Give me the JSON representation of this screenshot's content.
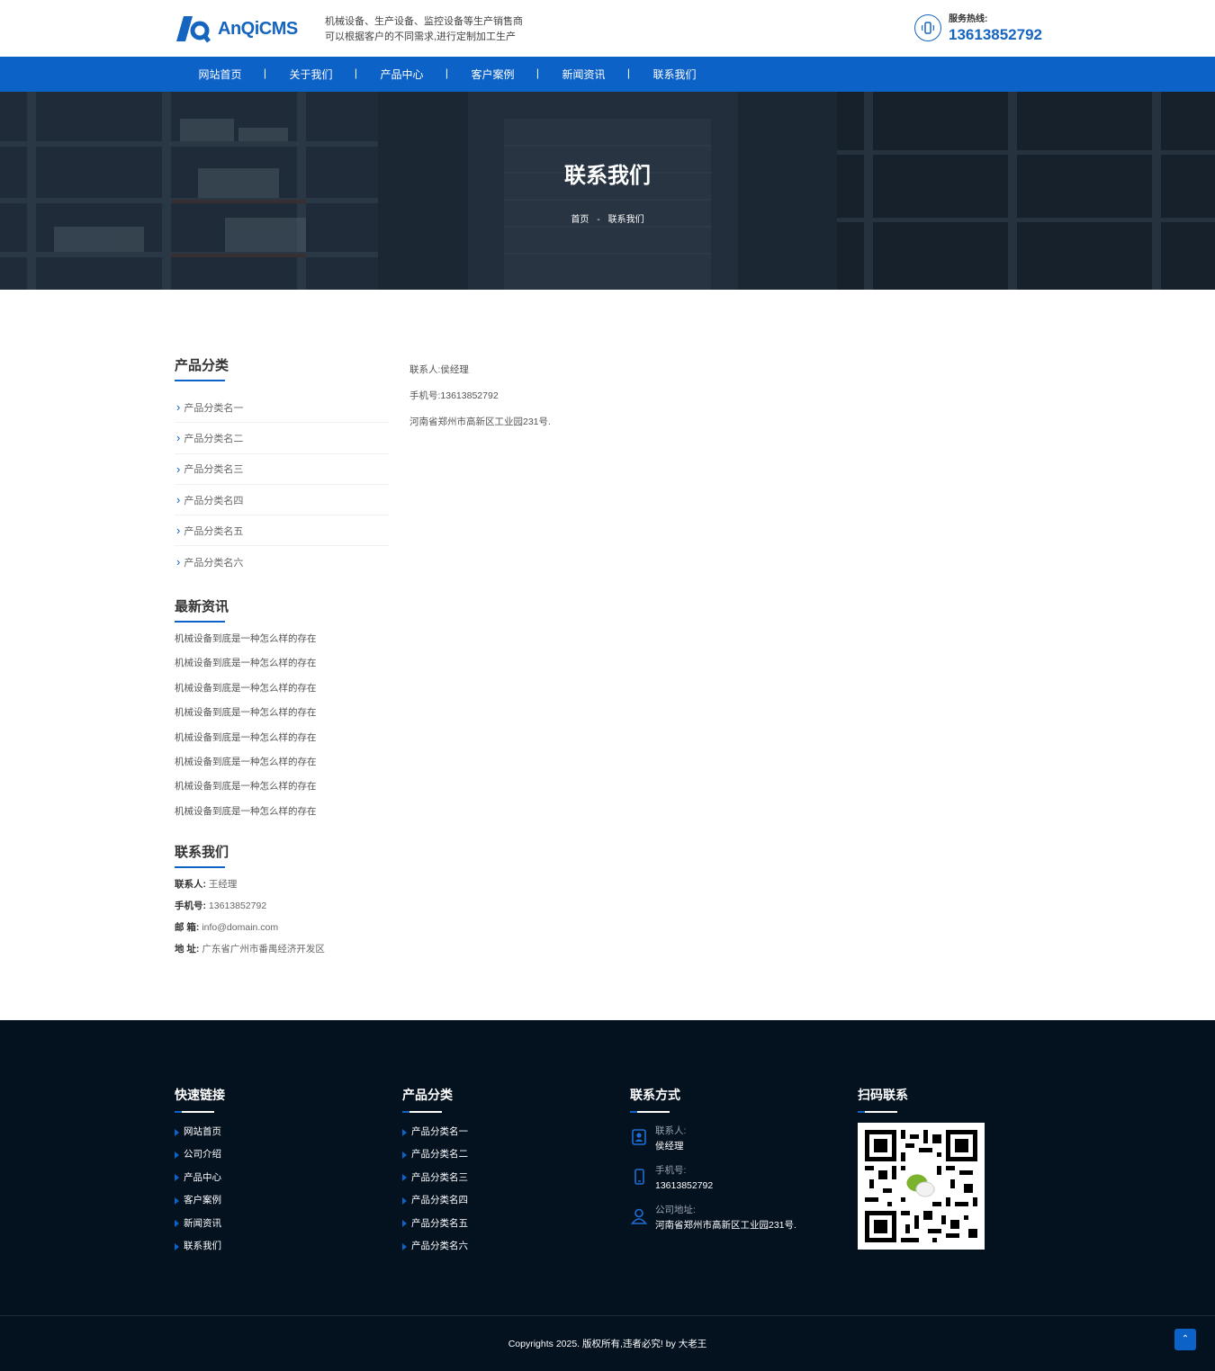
{
  "header": {
    "logo_text": "AnQiCMS",
    "tagline_line1": "机械设备、生产设备、监控设备等生产销售商",
    "tagline_line2": "可以根据客户的不同需求,进行定制加工生产",
    "hotline_label": "服务热线:",
    "hotline_number": "13613852792"
  },
  "nav": {
    "items": [
      {
        "label": "网站首页"
      },
      {
        "label": "关于我们"
      },
      {
        "label": "产品中心"
      },
      {
        "label": "客户案例"
      },
      {
        "label": "新闻资讯"
      },
      {
        "label": "联系我们"
      }
    ]
  },
  "banner": {
    "title": "联系我们",
    "breadcrumb_home": "首页",
    "breadcrumb_sep": "-",
    "breadcrumb_current": "联系我们"
  },
  "sidebar": {
    "categories_title": "产品分类",
    "categories": [
      "产品分类名一",
      "产品分类名二",
      "产品分类名三",
      "产品分类名四",
      "产品分类名五",
      "产品分类名六"
    ],
    "news_title": "最新资讯",
    "news": [
      "机械设备到底是一种怎么样的存在",
      "机械设备到底是一种怎么样的存在",
      "机械设备到底是一种怎么样的存在",
      "机械设备到底是一种怎么样的存在",
      "机械设备到底是一种怎么样的存在",
      "机械设备到底是一种怎么样的存在",
      "机械设备到底是一种怎么样的存在",
      "机械设备到底是一种怎么样的存在"
    ],
    "contact_title": "联系我们",
    "contact": [
      {
        "label": "联系人:",
        "value": "王经理"
      },
      {
        "label": "手机号:",
        "value": "13613852792"
      },
      {
        "label": "邮 箱:",
        "value": "info@domain.com"
      },
      {
        "label": "地 址:",
        "value": "广东省广州市番禺经济开发区"
      }
    ]
  },
  "main": {
    "lines": [
      "联系人:侯经理",
      "手机号:13613852792",
      "河南省郑州市高新区工业园231号."
    ]
  },
  "footer": {
    "quick_title": "快速链接",
    "quick_links": [
      "网站首页",
      "公司介绍",
      "产品中心",
      "客户案例",
      "新闻资讯",
      "联系我们"
    ],
    "cat_title": "产品分类",
    "cat_links": [
      "产品分类名一",
      "产品分类名二",
      "产品分类名三",
      "产品分类名四",
      "产品分类名五",
      "产品分类名六"
    ],
    "contact_title": "联系方式",
    "contact_person_label": "联系人:",
    "contact_person": "侯经理",
    "phone_label": "手机号:",
    "phone": "13613852792",
    "address_label": "公司地址:",
    "address": "河南省郑州市高新区工业园231号.",
    "qr_title": "扫码联系",
    "copyright": "Copyrights 2025. 版权所有,违者必究! by 大老王",
    "back_top": "⌃"
  },
  "colors": {
    "brand_blue": "#0d62c8",
    "footer_bg": "#04111f"
  }
}
